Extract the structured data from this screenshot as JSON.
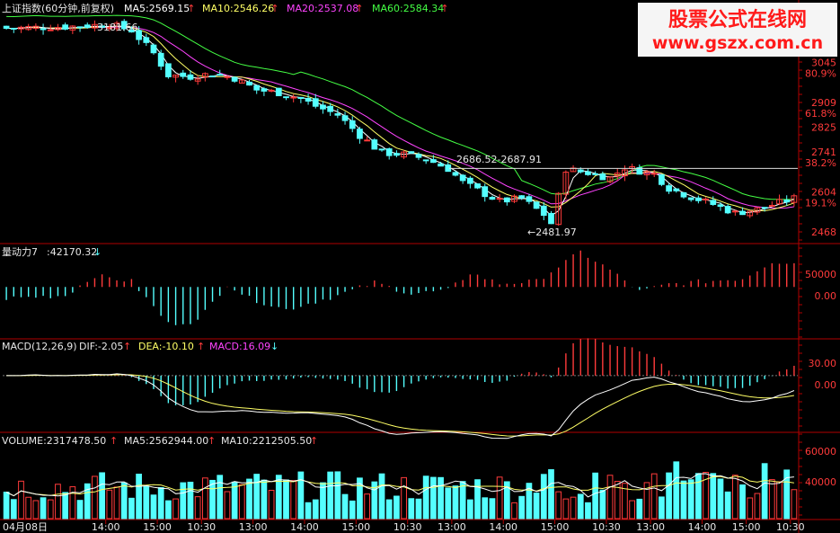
{
  "colors": {
    "up": "#ff3b3b",
    "down": "#54ffff",
    "frame": "#b00000",
    "text": "#e8e8e8",
    "ma5": "#ffffff",
    "ma10": "#ffff66",
    "ma20": "#ff44ff",
    "ma60": "#44ff44",
    "watermark_bg": "#f5f5f5",
    "watermark_red": "#ff1a1a"
  },
  "watermark": {
    "line1": "股票公式在线网",
    "line2": "www.gszx.com.cn"
  },
  "price_panel": {
    "title": "上证指数(60分钟,前复权)",
    "legend": [
      {
        "key": "ma5",
        "text": "MA5:2569.15",
        "arrow": "↑"
      },
      {
        "key": "ma10",
        "text": "MA10:2546.26",
        "arrow": "↑"
      },
      {
        "key": "ma20",
        "text": "MA20:2537.08",
        "arrow": "↑"
      },
      {
        "key": "ma60",
        "text": "MA60:2584.34",
        "arrow": "↑"
      }
    ],
    "y_ticks": [
      {
        "v": 3045,
        "label": "3045",
        "pct": "80.9%"
      },
      {
        "v": 2909,
        "label": "2909",
        "pct": "61.8%"
      },
      {
        "v": 2825,
        "label": "2825"
      },
      {
        "v": 2741,
        "label": "2741",
        "pct": "38.2%"
      },
      {
        "v": 2604,
        "label": "2604",
        "pct": "19.1%"
      },
      {
        "v": 2468,
        "label": "2468"
      }
    ],
    "annotations": {
      "high_label": "3181.66",
      "high_value": 3181.66,
      "range_label": "2686.52-2687.91",
      "range_value": 2687,
      "low_label": "←2481.97",
      "low_value": 2481.97
    }
  },
  "momentum_panel": {
    "title": "量动力7",
    "value": ":42170.32",
    "arrow": "↓",
    "y_ticks": [
      "50000",
      "0.00"
    ]
  },
  "macd_panel": {
    "title": "MACD(12,26,9)",
    "dif": "DIF:-2.05",
    "dea": "DEA:-10.10",
    "macd": "MACD:16.09",
    "arrow": "↑",
    "arrow_down": "↓",
    "y_ticks": [
      "30.00",
      "0.00"
    ]
  },
  "volume_panel": {
    "title": "VOLUME:2317478.50",
    "ma5": "MA5:2562944.00",
    "ma10": "MA10:2212505.50",
    "arrow": "↑",
    "y_ticks": [
      "60000",
      "40000"
    ]
  },
  "x_axis": {
    "date": "04月08日",
    "ticks": [
      "14:00",
      "15:00",
      "10:30",
      "13:00",
      "14:00",
      "15:00",
      "10:30",
      "13:00",
      "14:00",
      "15:00",
      "10:30",
      "13:00",
      "14:00",
      "15:00",
      "10:30"
    ]
  },
  "chart_data": {
    "type": "candlestick",
    "title": "上证指数(60分钟,前复权)",
    "bars": 108,
    "close_path_keypoints": [
      [
        0,
        3165
      ],
      [
        8,
        3170
      ],
      [
        14,
        3178
      ],
      [
        17,
        3158
      ],
      [
        20,
        3080
      ],
      [
        22,
        3005
      ],
      [
        25,
        3000
      ],
      [
        28,
        3010
      ],
      [
        31,
        2995
      ],
      [
        34,
        2955
      ],
      [
        37,
        2945
      ],
      [
        40,
        2925
      ],
      [
        42,
        2900
      ],
      [
        45,
        2870
      ],
      [
        48,
        2800
      ],
      [
        51,
        2740
      ],
      [
        54,
        2735
      ],
      [
        57,
        2720
      ],
      [
        60,
        2686
      ],
      [
        62,
        2640
      ],
      [
        65,
        2600
      ],
      [
        67,
        2575
      ],
      [
        70,
        2585
      ],
      [
        73,
        2530
      ],
      [
        74,
        2500
      ],
      [
        76,
        2685
      ],
      [
        79,
        2672
      ],
      [
        82,
        2655
      ],
      [
        84,
        2690
      ],
      [
        88,
        2668
      ],
      [
        90,
        2620
      ],
      [
        93,
        2590
      ],
      [
        96,
        2565
      ],
      [
        99,
        2535
      ],
      [
        102,
        2548
      ],
      [
        105,
        2570
      ],
      [
        107,
        2585
      ]
    ],
    "price_range": [
      2440,
      3200
    ],
    "momentum_range": [
      -90000,
      75000
    ],
    "macd_range": [
      -70,
      45
    ],
    "volume_range": [
      0,
      75000
    ]
  }
}
